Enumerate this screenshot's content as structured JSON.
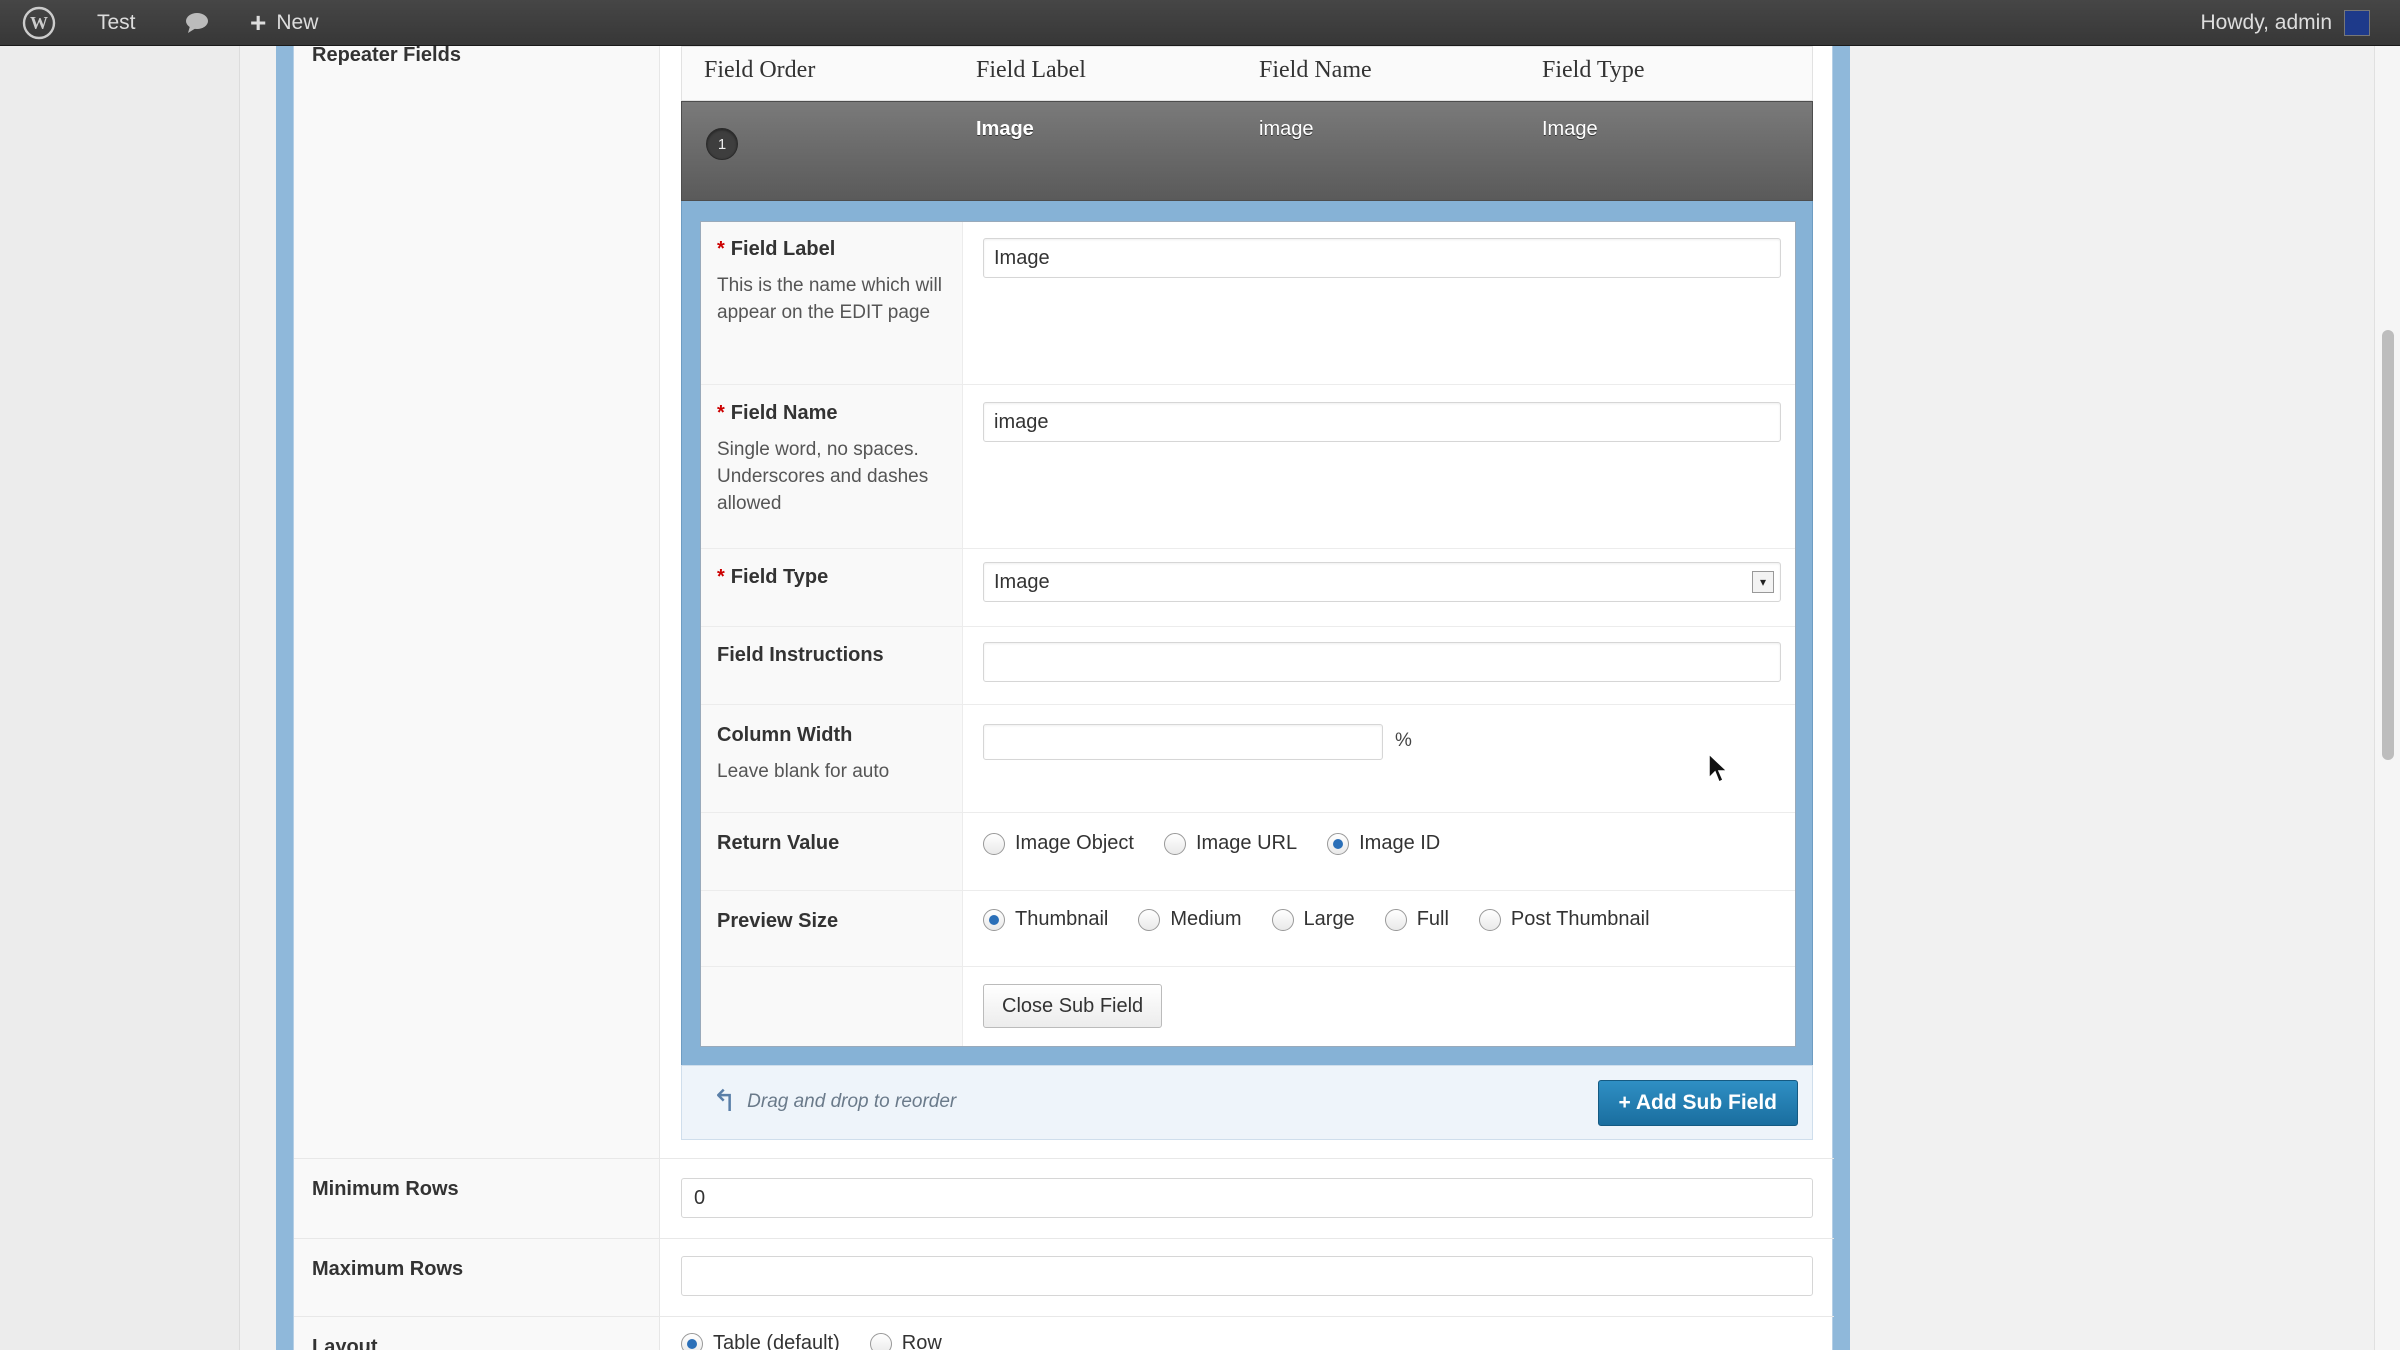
{
  "adminbar": {
    "site_name": "Test",
    "new_label": "New",
    "howdy": "Howdy, admin",
    "icons": [
      "wordpress-logo-icon",
      "comment-bubble-icon",
      "plus-icon",
      "avatar"
    ]
  },
  "field": {
    "repeater_label": "Repeater Fields",
    "columns": [
      "Field Order",
      "Field Label",
      "Field Name",
      "Field Type"
    ],
    "row": {
      "order": "1",
      "label": "Image",
      "name": "image",
      "type": "Image"
    }
  },
  "subfield": {
    "label": {
      "title": "Field Label",
      "desc": "This is the name which will appear on the EDIT page",
      "value": "Image"
    },
    "name": {
      "title": "Field Name",
      "desc": "Single word, no spaces. Underscores and dashes allowed",
      "value": "image"
    },
    "type": {
      "title": "Field Type",
      "value": "Image"
    },
    "instructions": {
      "title": "Field Instructions",
      "value": ""
    },
    "width": {
      "title": "Column Width",
      "desc": "Leave blank for auto",
      "unit": "%",
      "value": ""
    },
    "return_value": {
      "title": "Return Value",
      "options": [
        "Image Object",
        "Image URL",
        "Image ID"
      ],
      "selected": "Image ID"
    },
    "preview_size": {
      "title": "Preview Size",
      "options": [
        "Thumbnail",
        "Medium",
        "Large",
        "Full",
        "Post Thumbnail"
      ],
      "selected": "Thumbnail"
    },
    "close_label": "Close Sub Field"
  },
  "footer": {
    "drag_hint": "Drag and drop to reorder",
    "add_label": "+ Add Sub Field"
  },
  "settings": {
    "min_rows": {
      "label": "Minimum Rows",
      "value": "0"
    },
    "max_rows": {
      "label": "Maximum Rows",
      "value": ""
    },
    "layout": {
      "label": "Layout",
      "options": [
        "Table (default)",
        "Row"
      ],
      "selected": "Table (default)"
    }
  },
  "colors": {
    "accent_blue": "#1a6e9f",
    "frame_blue": "#8fb8da",
    "row_dark": "#5a5a5a",
    "required_red": "#cc0000"
  }
}
